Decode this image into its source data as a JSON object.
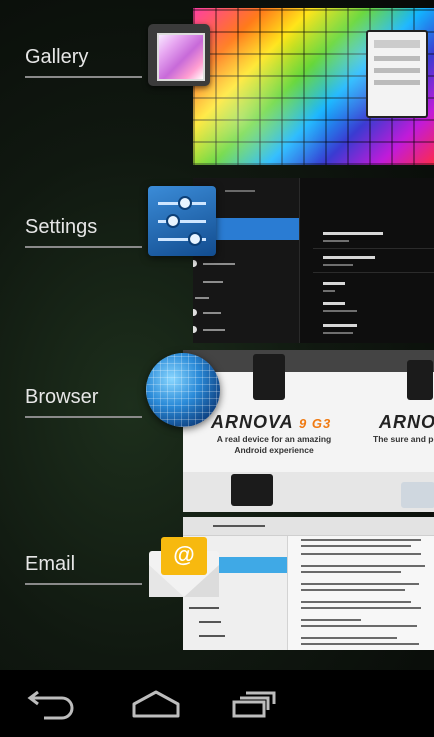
{
  "recents": {
    "apps": [
      {
        "label": "Gallery",
        "icon": "gallery-icon"
      },
      {
        "label": "Settings",
        "icon": "settings-sliders-icon"
      },
      {
        "label": "Browser",
        "icon": "globe-icon"
      },
      {
        "label": "Email",
        "icon": "envelope-icon"
      }
    ],
    "browser_preview": {
      "brand_left": "ARNOVA",
      "brand_left_suffix": "9 G3",
      "brand_right": "ARNO",
      "tagline_left": "A real device for an amazing\nAndroid experience",
      "tagline_right": "The sure and pow"
    }
  },
  "navbar": {
    "back": "back-arrow-icon",
    "home": "home-icon",
    "recents": "recent-apps-icon"
  }
}
